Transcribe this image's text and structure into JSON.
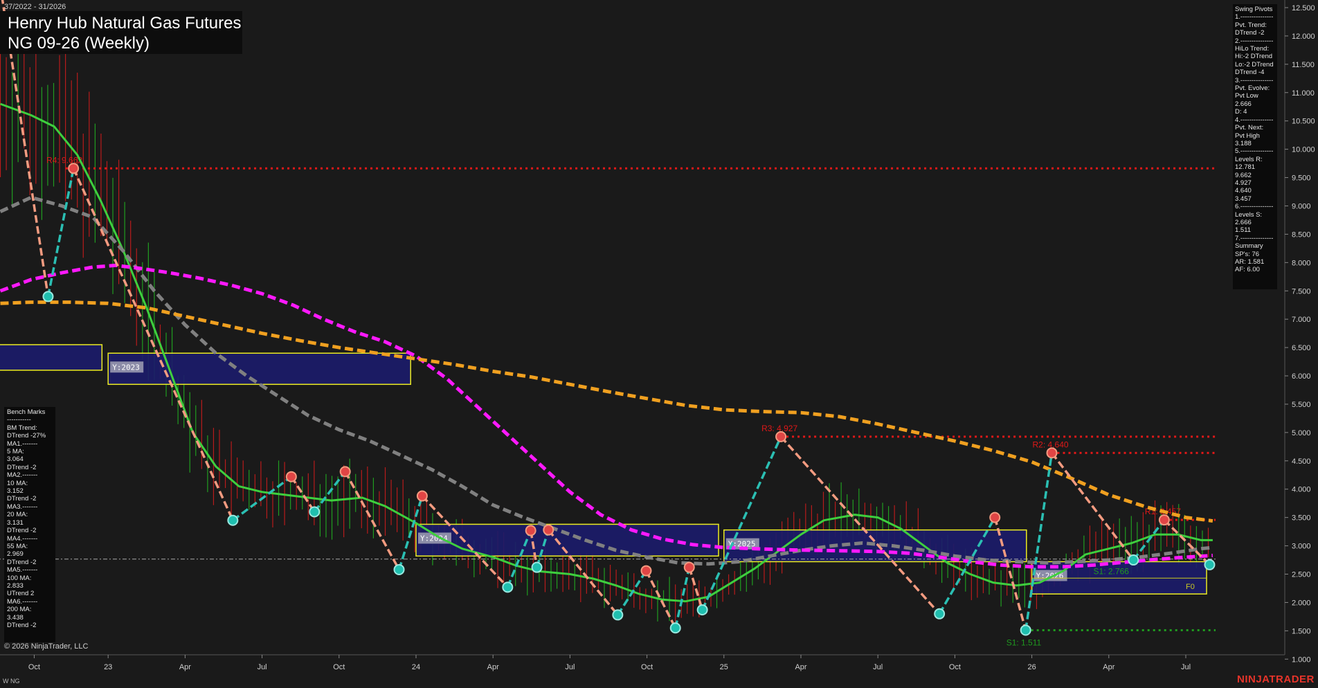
{
  "header": {
    "date_range": "37/2022 - 31/2026",
    "title_line1": "Henry Hub Natural Gas Futures",
    "title_line2": "NG 09-26 (Weekly)"
  },
  "swing_pivots_panel": [
    "Swing Pivots",
    "1.---------------",
    "Pvt. Trend:",
    "DTrend -2",
    "2.---------------",
    "HiLo Trend:",
    "Hi:-2 DTrend",
    "Lo:-2 DTrend",
    "DTrend -4",
    "3.---------------",
    "Pvt. Evolve:",
    "Pvt Low",
    "2.666",
    "D: 4",
    "4.---------------",
    "Pvt. Next:",
    "Pvt High",
    "3.188",
    "5.---------------",
    "Levels R:",
    "12.781",
    "9.662",
    "4.927",
    "4.640",
    "3.457",
    "6.---------------",
    "Levels S:",
    "2.666",
    "1.511",
    "7.---------------",
    "Summary",
    "SP's: 76",
    "AR: 1.581",
    "AF: 6.00"
  ],
  "bench_marks_panel": [
    "Bench Marks",
    "-----------",
    "BM Trend:",
    "DTrend -27%",
    "MA1.-------",
    "5 MA:",
    "3.064",
    "DTrend -2",
    "MA2.-------",
    "10 MA:",
    "3.152",
    "DTrend -2",
    "MA3.-------",
    "20 MA:",
    "3.131",
    "DTrend -2",
    "MA4.-------",
    "55 MA:",
    "2.969",
    "DTrend -2",
    "MA5.-------",
    "100 MA:",
    "2.833",
    "UTrend 2",
    "MA6.-------",
    "200 MA:",
    "3.438",
    "DTrend -2"
  ],
  "footer": {
    "copyright": "© 2026 NinjaTrader, LLC",
    "symbol": "W NG",
    "brand": "NINJATRADER"
  },
  "colors": {
    "background": "#1a1a1a",
    "up_bar": "#22b422",
    "down_bar": "#d41c1c",
    "ma_green": "#3ecf3e",
    "ma_gray": "#808080",
    "ma_magenta": "#ff19ff",
    "ma_orange": "#f0a020",
    "pivot_high_line": "#f39b80",
    "pivot_low_line": "#2bbfb3",
    "resistance": "#e01818",
    "support": "#1f9a1f",
    "zone_fill": "#1c1c6a",
    "zone_border": "#ffff22"
  },
  "chart_data": {
    "type": "line",
    "title": "Henry Hub Natural Gas Futures",
    "subtitle": "NG 09-26 (Weekly)",
    "y_axis_side": "right",
    "ylim": [
      0.8,
      12.6
    ],
    "y_ticks": [
      "12.500",
      "12.000",
      "11.500",
      "11.000",
      "10.500",
      "10.000",
      "9.500",
      "9.000",
      "8.500",
      "8.000",
      "7.500",
      "7.000",
      "6.500",
      "6.000",
      "5.500",
      "5.000",
      "4.500",
      "4.000",
      "3.500",
      "3.000",
      "2.500",
      "2.000",
      "1.500",
      "1.000"
    ],
    "x_ticks": [
      {
        "t": 0.04,
        "label": "Oct"
      },
      {
        "t": 1.0,
        "label": "23"
      },
      {
        "t": 2.0,
        "label": "Apr"
      },
      {
        "t": 3.0,
        "label": "Jul"
      },
      {
        "t": 4.0,
        "label": "Oct"
      },
      {
        "t": 5.0,
        "label": "24"
      },
      {
        "t": 6.0,
        "label": "Apr"
      },
      {
        "t": 7.0,
        "label": "Jul"
      },
      {
        "t": 8.0,
        "label": "Oct"
      },
      {
        "t": 9.0,
        "label": "25"
      },
      {
        "t": 10.0,
        "label": "Apr"
      },
      {
        "t": 11.0,
        "label": "Jul"
      },
      {
        "t": 12.0,
        "label": "Oct"
      },
      {
        "t": 13.0,
        "label": "26"
      },
      {
        "t": 14.0,
        "label": "Apr"
      },
      {
        "t": 15.0,
        "label": "Jul"
      }
    ],
    "series": [
      {
        "name": "5 MA",
        "color": "#3ecf3e",
        "dashed": false,
        "points": [
          [
            -0.4,
            10.8
          ],
          [
            0.0,
            10.6
          ],
          [
            0.3,
            10.4
          ],
          [
            0.6,
            9.9
          ],
          [
            0.9,
            9.1
          ],
          [
            1.2,
            8.2
          ],
          [
            1.5,
            7.2
          ],
          [
            1.8,
            6.1
          ],
          [
            2.1,
            5.0
          ],
          [
            2.4,
            4.4
          ],
          [
            2.7,
            4.05
          ],
          [
            3.0,
            3.95
          ],
          [
            3.3,
            3.9
          ],
          [
            3.6,
            3.85
          ],
          [
            3.9,
            3.8
          ],
          [
            4.3,
            3.85
          ],
          [
            4.6,
            3.7
          ],
          [
            5.0,
            3.4
          ],
          [
            5.3,
            3.15
          ],
          [
            5.6,
            2.95
          ],
          [
            6.0,
            2.8
          ],
          [
            6.3,
            2.65
          ],
          [
            6.6,
            2.55
          ],
          [
            7.0,
            2.5
          ],
          [
            7.3,
            2.42
          ],
          [
            7.6,
            2.3
          ],
          [
            7.9,
            2.15
          ],
          [
            8.2,
            2.05
          ],
          [
            8.5,
            2.02
          ],
          [
            8.8,
            2.1
          ],
          [
            9.1,
            2.35
          ],
          [
            9.4,
            2.6
          ],
          [
            9.7,
            2.9
          ],
          [
            10.0,
            3.2
          ],
          [
            10.3,
            3.45
          ],
          [
            10.7,
            3.55
          ],
          [
            11.0,
            3.5
          ],
          [
            11.3,
            3.3
          ],
          [
            11.6,
            3.0
          ],
          [
            11.9,
            2.7
          ],
          [
            12.2,
            2.5
          ],
          [
            12.5,
            2.35
          ],
          [
            12.8,
            2.3
          ],
          [
            13.1,
            2.35
          ],
          [
            13.4,
            2.55
          ],
          [
            13.7,
            2.85
          ],
          [
            14.0,
            2.95
          ],
          [
            14.3,
            3.05
          ],
          [
            14.6,
            3.2
          ],
          [
            14.9,
            3.2
          ],
          [
            15.2,
            3.1
          ],
          [
            15.35,
            3.1
          ]
        ]
      },
      {
        "name": "55 MA",
        "color": "#808080",
        "dashed": true,
        "points": [
          [
            -0.4,
            8.9
          ],
          [
            0.0,
            9.15
          ],
          [
            0.4,
            9.0
          ],
          [
            0.8,
            8.8
          ],
          [
            1.2,
            8.2
          ],
          [
            1.6,
            7.5
          ],
          [
            2.0,
            6.9
          ],
          [
            2.4,
            6.4
          ],
          [
            2.8,
            6.0
          ],
          [
            3.2,
            5.65
          ],
          [
            3.6,
            5.3
          ],
          [
            4.0,
            5.05
          ],
          [
            4.4,
            4.85
          ],
          [
            4.8,
            4.6
          ],
          [
            5.2,
            4.35
          ],
          [
            5.6,
            4.05
          ],
          [
            6.0,
            3.72
          ],
          [
            6.4,
            3.5
          ],
          [
            6.8,
            3.3
          ],
          [
            7.2,
            3.1
          ],
          [
            7.6,
            2.92
          ],
          [
            8.0,
            2.8
          ],
          [
            8.4,
            2.7
          ],
          [
            8.8,
            2.68
          ],
          [
            9.2,
            2.72
          ],
          [
            9.6,
            2.82
          ],
          [
            10.0,
            2.92
          ],
          [
            10.4,
            3.0
          ],
          [
            10.8,
            3.05
          ],
          [
            11.2,
            3.0
          ],
          [
            11.6,
            2.92
          ],
          [
            12.0,
            2.82
          ],
          [
            12.4,
            2.75
          ],
          [
            12.8,
            2.72
          ],
          [
            13.2,
            2.7
          ],
          [
            13.6,
            2.72
          ],
          [
            14.0,
            2.75
          ],
          [
            14.4,
            2.8
          ],
          [
            14.8,
            2.87
          ],
          [
            15.2,
            2.95
          ],
          [
            15.35,
            2.97
          ]
        ]
      },
      {
        "name": "100 MA",
        "color": "#ff19ff",
        "dashed": true,
        "points": [
          [
            -0.4,
            7.5
          ],
          [
            0.0,
            7.7
          ],
          [
            0.4,
            7.82
          ],
          [
            0.8,
            7.92
          ],
          [
            1.1,
            7.95
          ],
          [
            1.4,
            7.9
          ],
          [
            1.8,
            7.82
          ],
          [
            2.2,
            7.72
          ],
          [
            2.6,
            7.6
          ],
          [
            3.0,
            7.45
          ],
          [
            3.4,
            7.25
          ],
          [
            3.8,
            7.0
          ],
          [
            4.2,
            6.78
          ],
          [
            4.6,
            6.6
          ],
          [
            5.0,
            6.35
          ],
          [
            5.4,
            5.95
          ],
          [
            5.8,
            5.45
          ],
          [
            6.2,
            4.95
          ],
          [
            6.6,
            4.45
          ],
          [
            7.0,
            3.95
          ],
          [
            7.4,
            3.55
          ],
          [
            7.8,
            3.28
          ],
          [
            8.2,
            3.12
          ],
          [
            8.6,
            3.02
          ],
          [
            9.0,
            2.97
          ],
          [
            9.4,
            2.95
          ],
          [
            9.8,
            2.93
          ],
          [
            10.2,
            2.92
          ],
          [
            10.6,
            2.91
          ],
          [
            11.0,
            2.9
          ],
          [
            11.4,
            2.87
          ],
          [
            11.8,
            2.8
          ],
          [
            12.2,
            2.72
          ],
          [
            12.6,
            2.66
          ],
          [
            13.0,
            2.63
          ],
          [
            13.4,
            2.63
          ],
          [
            13.8,
            2.66
          ],
          [
            14.2,
            2.71
          ],
          [
            14.6,
            2.76
          ],
          [
            15.0,
            2.8
          ],
          [
            15.35,
            2.83
          ]
        ]
      },
      {
        "name": "200 MA",
        "color": "#f0a020",
        "dashed": true,
        "points": [
          [
            -0.4,
            7.28
          ],
          [
            0.0,
            7.3
          ],
          [
            0.5,
            7.3
          ],
          [
            1.0,
            7.28
          ],
          [
            1.5,
            7.2
          ],
          [
            2.0,
            7.05
          ],
          [
            2.5,
            6.9
          ],
          [
            3.0,
            6.75
          ],
          [
            3.5,
            6.62
          ],
          [
            4.0,
            6.5
          ],
          [
            4.5,
            6.4
          ],
          [
            5.0,
            6.3
          ],
          [
            5.5,
            6.2
          ],
          [
            6.0,
            6.08
          ],
          [
            6.5,
            5.98
          ],
          [
            7.0,
            5.85
          ],
          [
            7.5,
            5.72
          ],
          [
            8.0,
            5.6
          ],
          [
            8.5,
            5.48
          ],
          [
            9.0,
            5.4
          ],
          [
            9.5,
            5.37
          ],
          [
            10.0,
            5.35
          ],
          [
            10.5,
            5.28
          ],
          [
            11.0,
            5.15
          ],
          [
            11.5,
            5.0
          ],
          [
            12.0,
            4.85
          ],
          [
            12.5,
            4.68
          ],
          [
            13.0,
            4.48
          ],
          [
            13.5,
            4.2
          ],
          [
            14.0,
            3.9
          ],
          [
            14.5,
            3.68
          ],
          [
            15.0,
            3.5
          ],
          [
            15.35,
            3.44
          ]
        ]
      }
    ],
    "swing_path": [
      {
        "t": -0.38,
        "v": 12.7,
        "type": "high"
      },
      {
        "t": 0.22,
        "v": 7.4,
        "type": "low"
      },
      {
        "t": 0.55,
        "v": 9.662,
        "type": "high"
      },
      {
        "t": 2.62,
        "v": 3.45,
        "type": "low"
      },
      {
        "t": 3.38,
        "v": 4.22,
        "type": "high"
      },
      {
        "t": 3.68,
        "v": 3.6,
        "type": "low"
      },
      {
        "t": 4.08,
        "v": 4.31,
        "type": "high"
      },
      {
        "t": 4.78,
        "v": 2.58,
        "type": "low"
      },
      {
        "t": 5.08,
        "v": 3.88,
        "type": "high"
      },
      {
        "t": 6.19,
        "v": 2.27,
        "type": "low"
      },
      {
        "t": 6.49,
        "v": 3.27,
        "type": "high"
      },
      {
        "t": 6.57,
        "v": 2.62,
        "type": "low"
      },
      {
        "t": 6.72,
        "v": 3.28,
        "type": "high"
      },
      {
        "t": 7.62,
        "v": 1.78,
        "type": "low"
      },
      {
        "t": 7.99,
        "v": 2.56,
        "type": "high"
      },
      {
        "t": 8.37,
        "v": 1.55,
        "type": "low"
      },
      {
        "t": 8.55,
        "v": 2.62,
        "type": "high"
      },
      {
        "t": 8.72,
        "v": 1.87,
        "type": "low"
      },
      {
        "t": 9.74,
        "v": 4.927,
        "type": "high"
      },
      {
        "t": 11.8,
        "v": 1.8,
        "type": "low"
      },
      {
        "t": 12.52,
        "v": 3.5,
        "type": "high"
      },
      {
        "t": 12.92,
        "v": 1.511,
        "type": "low"
      },
      {
        "t": 13.26,
        "v": 4.64,
        "type": "high"
      },
      {
        "t": 14.32,
        "v": 2.75,
        "type": "low"
      },
      {
        "t": 14.72,
        "v": 3.457,
        "type": "high"
      },
      {
        "t": 15.31,
        "v": 2.666,
        "type": "low"
      }
    ],
    "levels": [
      {
        "label": "R4: 9.662",
        "value": 9.662,
        "from_t": 0.45,
        "kind": "resistance"
      },
      {
        "label": "R3: 4.927",
        "value": 4.927,
        "from_t": 9.74,
        "kind": "resistance"
      },
      {
        "label": "R2: 4.640",
        "value": 4.64,
        "from_t": 13.26,
        "kind": "resistance"
      },
      {
        "label": "R1: 3.457",
        "value": 3.457,
        "from_t": 14.72,
        "kind": "resistance"
      },
      {
        "label": "S1: 2.766",
        "value": 2.766,
        "from_t": -0.45,
        "kind": "reference"
      },
      {
        "label": "S1: 1.511",
        "value": 1.511,
        "from_t": 12.92,
        "kind": "support"
      }
    ],
    "year_zones": [
      {
        "label": "",
        "t0": -0.45,
        "t1": 0.92,
        "v0": 6.1,
        "v1": 6.55
      },
      {
        "label": "Y:2023",
        "t0": 1.0,
        "t1": 4.93,
        "v0": 5.85,
        "v1": 6.4
      },
      {
        "label": "Y:2024",
        "t0": 5.0,
        "t1": 8.93,
        "v0": 2.82,
        "v1": 3.38
      },
      {
        "label": "Y:2025",
        "t0": 9.0,
        "t1": 12.93,
        "v0": 2.72,
        "v1": 3.28
      },
      {
        "label": "Y:2026",
        "t0": 13.0,
        "t1": 15.27,
        "v0": 2.15,
        "v1": 2.72
      }
    ],
    "f0_label": "F0",
    "f0_value": 2.43,
    "last_price": 2.666
  }
}
